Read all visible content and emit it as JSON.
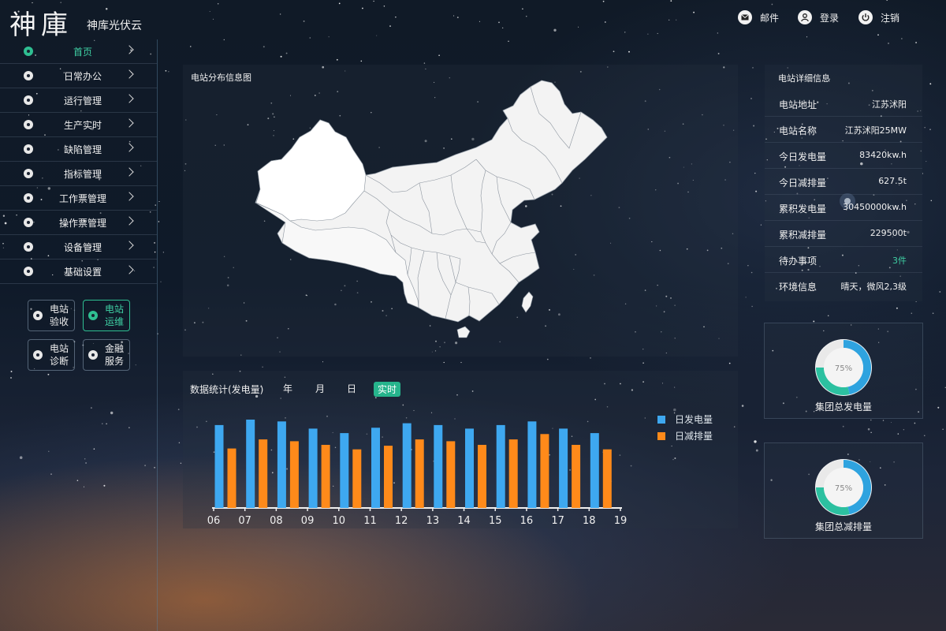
{
  "header": {
    "logo": "神庫",
    "subtitle": "神库光伏云",
    "mail_label": "邮件",
    "login_label": "登录",
    "logout_label": "注销"
  },
  "sidebar": {
    "items": [
      {
        "label": "首页",
        "icon": "home-icon"
      },
      {
        "label": "日常办公",
        "icon": "office-icon"
      },
      {
        "label": "运行管理",
        "icon": "operation-icon"
      },
      {
        "label": "生产实时",
        "icon": "production-icon"
      },
      {
        "label": "缺陷管理",
        "icon": "defect-icon"
      },
      {
        "label": "指标管理",
        "icon": "indicator-icon"
      },
      {
        "label": "工作票管理",
        "icon": "work-ticket-icon"
      },
      {
        "label": "操作票管理",
        "icon": "operation-ticket-icon"
      },
      {
        "label": "设备管理",
        "icon": "device-icon"
      },
      {
        "label": "基础设置",
        "icon": "settings-icon"
      }
    ],
    "quick": [
      {
        "line1": "电站",
        "line2": "验收"
      },
      {
        "line1": "电站",
        "line2": "运维"
      },
      {
        "line1": "电站",
        "line2": "诊断"
      },
      {
        "line1": "金融",
        "line2": "服务"
      }
    ]
  },
  "map": {
    "title": "电站分布信息图"
  },
  "stats": {
    "title": "数据统计(发电量)",
    "tabs": [
      "年",
      "月",
      "日",
      "实时"
    ],
    "active_tab": "实时"
  },
  "chart_data": {
    "type": "bar",
    "categories": [
      "06",
      "07",
      "08",
      "09",
      "10",
      "11",
      "12",
      "13",
      "14",
      "15",
      "16",
      "17",
      "18",
      "19"
    ],
    "series": [
      {
        "name": "日发电量",
        "color": "#3ea8f0",
        "values": [
          92,
          98,
          96,
          88,
          83,
          89,
          94,
          92,
          88,
          92,
          96,
          88,
          83,
          null
        ]
      },
      {
        "name": "日减排量",
        "color": "#ff8a1a",
        "values": [
          66,
          76,
          74,
          70,
          65,
          69,
          76,
          74,
          70,
          76,
          82,
          70,
          65,
          null
        ]
      }
    ],
    "ylim": [
      0,
      105
    ],
    "legend": "right"
  },
  "detail": {
    "title": "电站详细信息",
    "rows": [
      {
        "k": "电站地址",
        "v": "江苏沭阳"
      },
      {
        "k": "电站名称",
        "v": "江苏沭阳25MW"
      },
      {
        "k": "今日发电量",
        "v": "83420kw.h"
      },
      {
        "k": "今日减排量",
        "v": "627.5t"
      },
      {
        "k": "累积发电量",
        "v": "30450000kw.h"
      },
      {
        "k": "累积减排量",
        "v": "229500t"
      },
      {
        "k": "待办事项",
        "v": "3件"
      },
      {
        "k": "环境信息",
        "v": "晴天，微风2,3级"
      }
    ],
    "todo_color": "#3fd0a4"
  },
  "donuts": [
    {
      "label": "集团总发电量",
      "percent_text": "75%",
      "percent": 75
    },
    {
      "label": "集团总减排量",
      "percent_text": "75%",
      "percent": 75
    }
  ]
}
